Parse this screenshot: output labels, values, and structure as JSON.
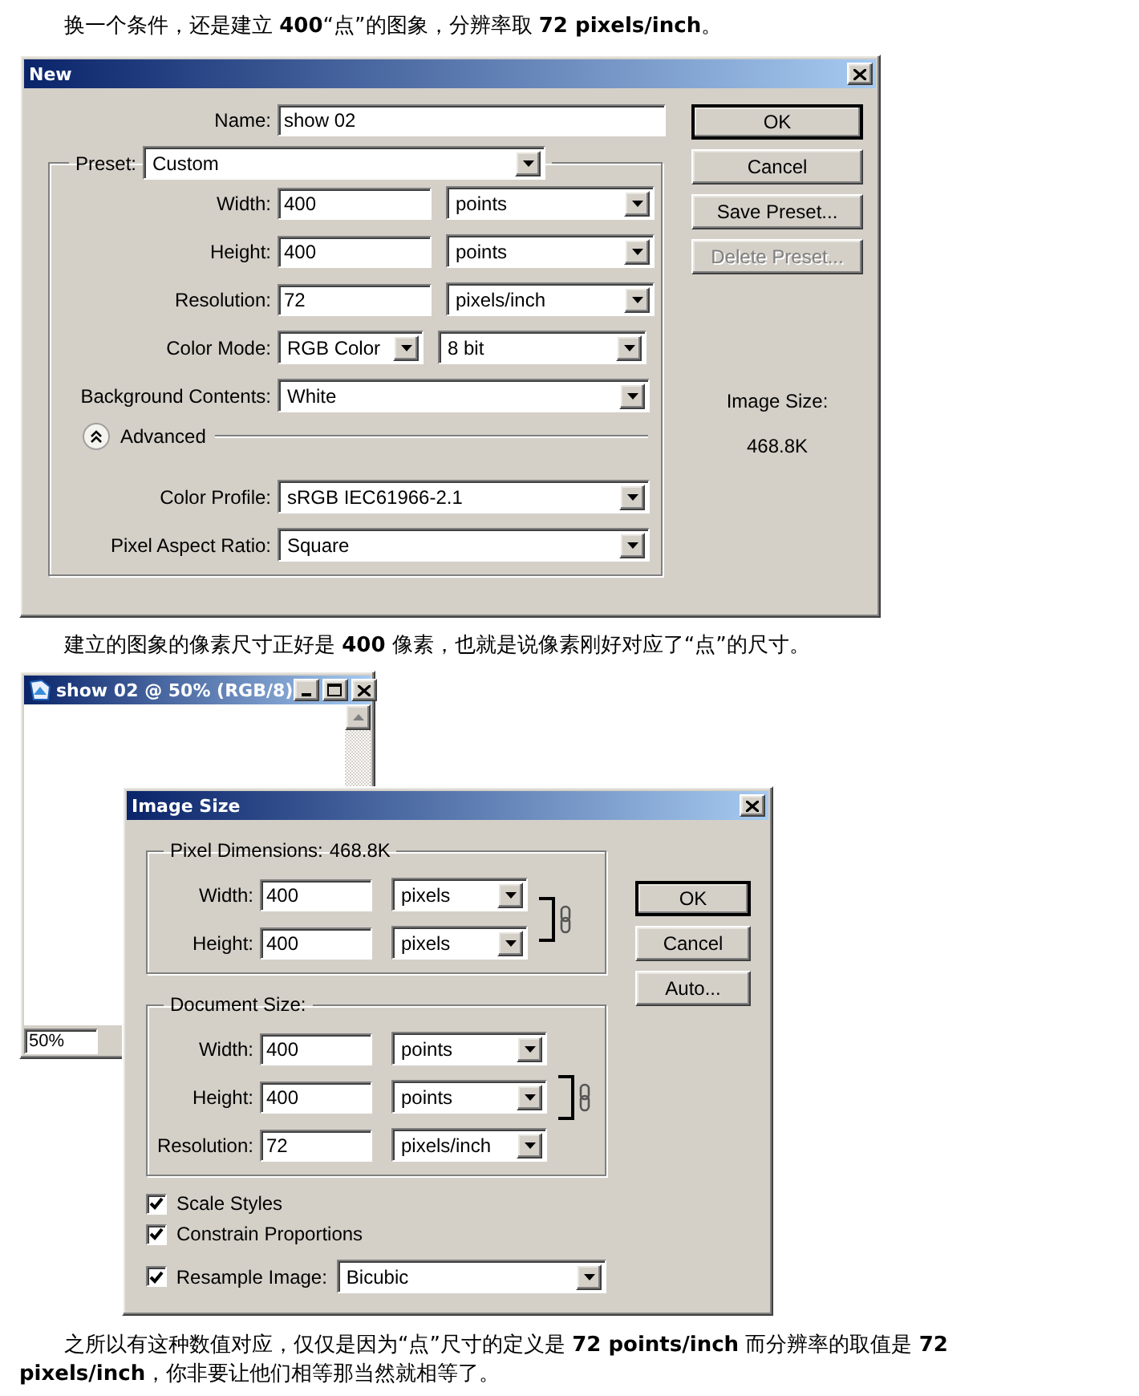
{
  "intro": "换一个条件，还是建立 **400**“点”的图象，分辨率取 **72 pixels/inch**。",
  "new_dialog": {
    "title": "New",
    "name": {
      "label": "Name:",
      "value": "show 02"
    },
    "preset": {
      "label": "Preset:",
      "value": "Custom"
    },
    "size_rows": [
      {
        "label": "Width:",
        "value": "400",
        "unit": "points"
      },
      {
        "label": "Height:",
        "value": "400",
        "unit": "points"
      },
      {
        "label": "Resolution:",
        "value": "72",
        "unit": "pixels/inch"
      }
    ],
    "color_mode": {
      "label": "Color Mode:",
      "value": "RGB Color",
      "depth": "8 bit"
    },
    "background": {
      "label": "Background Contents:",
      "value": "White"
    },
    "advanced": {
      "label": "Advanced",
      "expanded": true
    },
    "advanced_rows": [
      {
        "label": "Color Profile:",
        "value": "sRGB IEC61966-2.1"
      },
      {
        "label": "Pixel Aspect Ratio:",
        "value": "Square"
      }
    ],
    "buttons": [
      {
        "label": "OK",
        "default": true,
        "disabled": false
      },
      {
        "label": "Cancel",
        "default": false,
        "disabled": false
      },
      {
        "label": "Save Preset...",
        "default": false,
        "disabled": false
      },
      {
        "label": "Delete Preset...",
        "default": false,
        "disabled": true
      }
    ],
    "image_size": {
      "label": "Image Size:",
      "value": "468.8K"
    }
  },
  "caption": "建立的图象的像素尺寸正好是 **400** 像素，也就是说像素刚好对应了“点”的尺寸。",
  "document_window": {
    "title": "show 02 @ 50% (RGB/8)",
    "zoom": "50%"
  },
  "image_size_dialog": {
    "title": "Image Size",
    "pixel_dimensions": {
      "label": "Pixel Dimensions:",
      "value": "468.8K",
      "rows": [
        {
          "label": "Width:",
          "value": "400",
          "unit": "pixels"
        },
        {
          "label": "Height:",
          "value": "400",
          "unit": "pixels"
        }
      ]
    },
    "document_size": {
      "label": "Document Size:",
      "rows": [
        {
          "label": "Width:",
          "value": "400",
          "unit": "points"
        },
        {
          "label": "Height:",
          "value": "400",
          "unit": "points"
        },
        {
          "label": "Resolution:",
          "value": "72",
          "unit": "pixels/inch"
        }
      ]
    },
    "options": [
      {
        "label": "Scale Styles",
        "checked": true
      },
      {
        "label": "Constrain Proportions",
        "checked": true
      }
    ],
    "resample": {
      "label": "Resample Image:",
      "checked": true,
      "value": "Bicubic"
    },
    "buttons": [
      {
        "label": "OK",
        "default": true,
        "disabled": false
      },
      {
        "label": "Cancel",
        "default": false,
        "disabled": false
      },
      {
        "label": "Auto...",
        "default": false,
        "disabled": false
      }
    ]
  },
  "conclusion": "之所以有这种数值对应，仅仅是因为“点”尺寸的定义是 **72 points/inch** 而分辨率的取值是 **72 pixels/inch**，你非要让他们相等那当然就相等了。"
}
